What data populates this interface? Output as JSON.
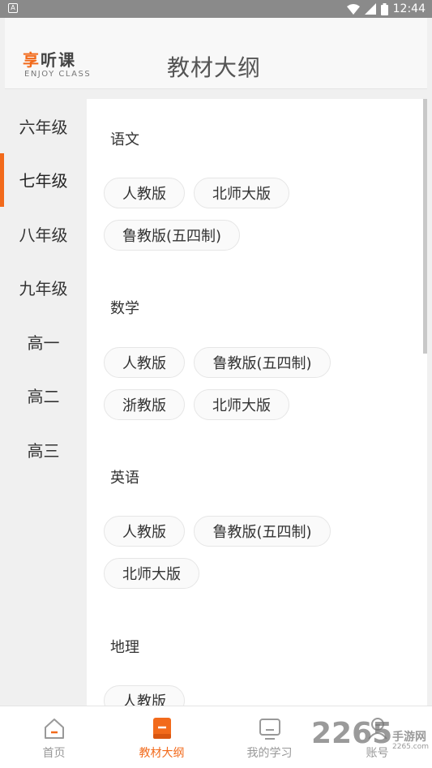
{
  "status_bar": {
    "time": "12:44"
  },
  "header": {
    "logo_accent": "享",
    "logo_rest": "听课",
    "logo_sub": "ENJOY CLASS",
    "title": "教材大纲"
  },
  "sidebar": {
    "grades": [
      {
        "label": "六年级",
        "active": false
      },
      {
        "label": "七年级",
        "active": true
      },
      {
        "label": "八年级",
        "active": false
      },
      {
        "label": "九年级",
        "active": false
      },
      {
        "label": "高一",
        "active": false
      },
      {
        "label": "高二",
        "active": false
      },
      {
        "label": "高三",
        "active": false
      }
    ]
  },
  "subjects": [
    {
      "name": "语文",
      "editions": [
        "人教版",
        "北师大版",
        "鲁教版(五四制)"
      ]
    },
    {
      "name": "数学",
      "editions": [
        "人教版",
        "鲁教版(五四制)",
        "浙教版",
        "北师大版"
      ]
    },
    {
      "name": "英语",
      "editions": [
        "人教版",
        "鲁教版(五四制)",
        "北师大版"
      ]
    },
    {
      "name": "地理",
      "editions": [
        "人教版"
      ]
    }
  ],
  "bottom_nav": {
    "items": [
      {
        "label": "首页",
        "icon": "home-icon"
      },
      {
        "label": "教材大纲",
        "icon": "book-icon",
        "active": true
      },
      {
        "label": "我的学习",
        "icon": "monitor-icon"
      },
      {
        "label": "账号",
        "icon": "person-icon"
      }
    ]
  },
  "watermark": {
    "number": "2265",
    "text": "手游网",
    "url": "2265.com"
  },
  "colors": {
    "accent": "#f26a1b"
  }
}
